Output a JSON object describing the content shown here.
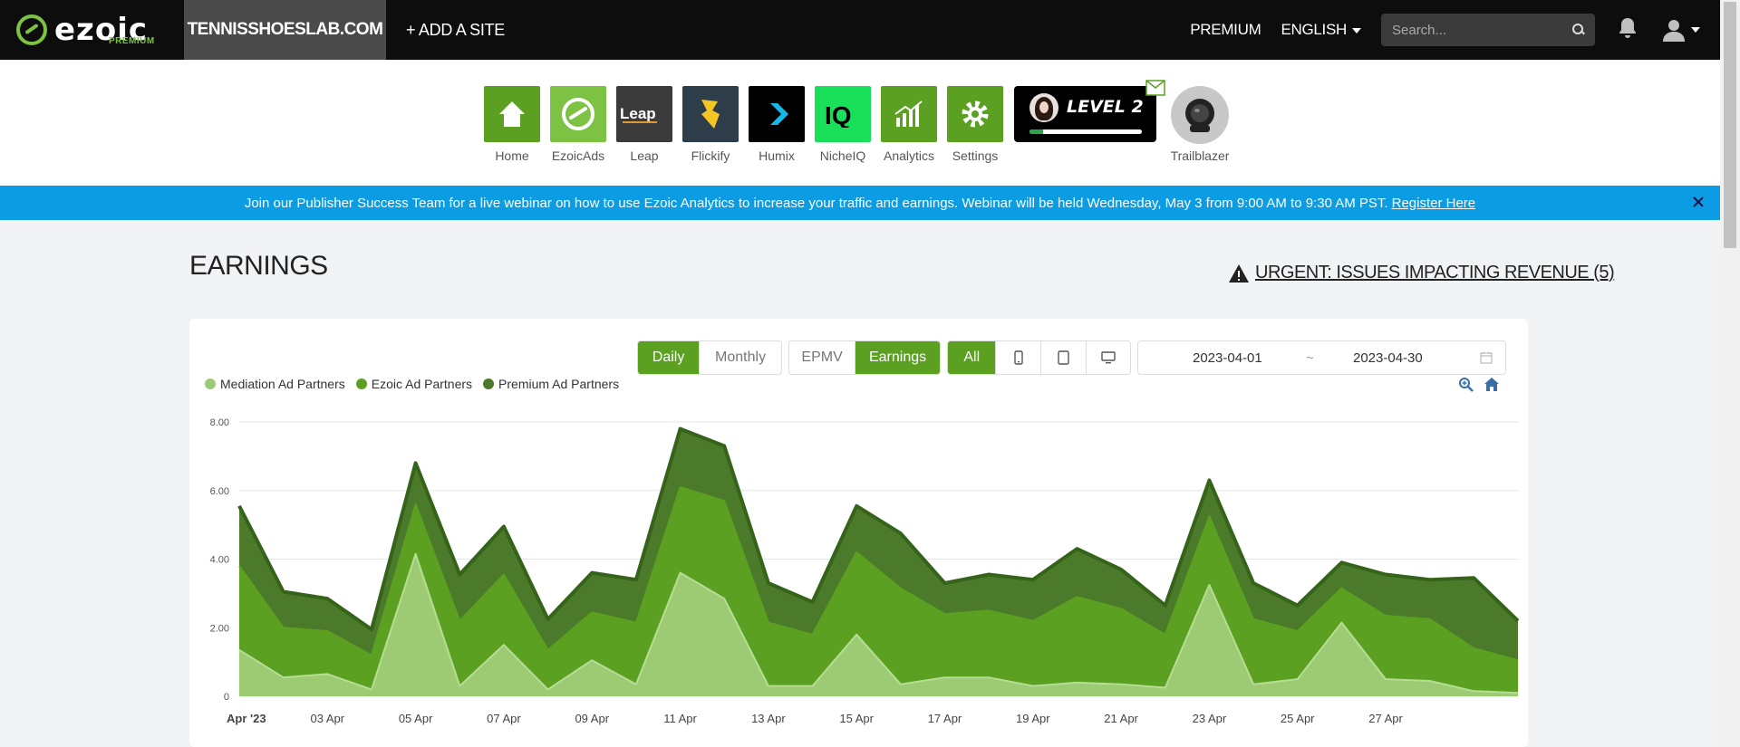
{
  "brand": {
    "name": "ezoic",
    "tag": "PREMIUM"
  },
  "nav": {
    "site": "TENNISSHOESLAB.COM",
    "add_site": "+ ADD A SITE",
    "premium": "PREMIUM",
    "language": "ENGLISH",
    "search_placeholder": "Search..."
  },
  "apps": [
    {
      "label": "Home",
      "color": "#5ba021",
      "icon": "home-icon"
    },
    {
      "label": "EzoicAds",
      "color": "#7dc242",
      "icon": "ezoic-icon"
    },
    {
      "label": "Leap",
      "color": "#3b3b3b",
      "icon": "leap-icon"
    },
    {
      "label": "Flickify",
      "color": "#2e3d4a",
      "icon": "flickify-icon"
    },
    {
      "label": "Humix",
      "color": "#000000",
      "icon": "humix-icon"
    },
    {
      "label": "NicheIQ",
      "color": "#19e058",
      "icon": "nicheiq-icon"
    },
    {
      "label": "Analytics",
      "color": "#5ba021",
      "icon": "analytics-icon"
    },
    {
      "label": "Settings",
      "color": "#5ba021",
      "icon": "settings-icon"
    }
  ],
  "level": {
    "label": "LEVEL 2",
    "progress": 0.12
  },
  "trailblazer": {
    "label": "Trailblazer"
  },
  "banner": {
    "text": "Join our Publisher Success Team for a live webinar on how to use Ezoic Analytics to increase your traffic and earnings. Webinar will be held Wednesday, May 3 from 9:00 AM to 9:30 AM PST.",
    "link": "Register Here"
  },
  "page": {
    "title": "EARNINGS",
    "urgent": "URGENT: ISSUES IMPACTING REVENUE (5)"
  },
  "controls": {
    "period": [
      "Daily",
      "Monthly"
    ],
    "metric": [
      "EPMV",
      "Earnings"
    ],
    "device_all": "All",
    "date_start": "2023-04-01",
    "date_sep": "~",
    "date_end": "2023-04-30"
  },
  "chart_data": {
    "type": "area",
    "stacked": true,
    "yticks": [
      "0",
      "2.00",
      "4.00",
      "6.00",
      "8.00"
    ],
    "ylim": [
      0,
      8
    ],
    "xticks": [
      {
        "day": 1,
        "label": "Apr '23"
      },
      {
        "day": 3,
        "label": "03 Apr"
      },
      {
        "day": 5,
        "label": "05 Apr"
      },
      {
        "day": 7,
        "label": "07 Apr"
      },
      {
        "day": 9,
        "label": "09 Apr"
      },
      {
        "day": 11,
        "label": "11 Apr"
      },
      {
        "day": 13,
        "label": "13 Apr"
      },
      {
        "day": 15,
        "label": "15 Apr"
      },
      {
        "day": 17,
        "label": "17 Apr"
      },
      {
        "day": 19,
        "label": "19 Apr"
      },
      {
        "day": 21,
        "label": "21 Apr"
      },
      {
        "day": 23,
        "label": "23 Apr"
      },
      {
        "day": 25,
        "label": "25 Apr"
      },
      {
        "day": 27,
        "label": "27 Apr"
      }
    ],
    "days": [
      1,
      2,
      3,
      4,
      5,
      6,
      7,
      8,
      9,
      10,
      11,
      12,
      13,
      14,
      15,
      16,
      17,
      18,
      19,
      20,
      21,
      22,
      23,
      24,
      25,
      26,
      27,
      28,
      29,
      30
    ],
    "series": [
      {
        "name": "Mediation Ad Partners",
        "color": "#9ccb74",
        "values": [
          1.35,
          0.55,
          0.65,
          0.2,
          4.15,
          0.3,
          1.5,
          0.2,
          1.05,
          0.35,
          3.6,
          2.85,
          0.3,
          0.3,
          1.8,
          0.35,
          0.55,
          0.55,
          0.3,
          0.4,
          0.35,
          0.25,
          3.25,
          0.35,
          0.5,
          2.15,
          0.5,
          0.45,
          0.15,
          0.1
        ]
      },
      {
        "name": "Ezoic Ad Partners",
        "color": "#5ba021",
        "values": [
          2.45,
          1.45,
          1.25,
          1.0,
          1.45,
          1.9,
          2.05,
          1.15,
          1.4,
          1.8,
          2.5,
          2.85,
          1.85,
          1.5,
          2.4,
          2.8,
          1.85,
          1.95,
          1.9,
          2.5,
          2.2,
          1.55,
          2.0,
          1.9,
          1.4,
          1.0,
          1.85,
          1.8,
          1.25,
          0.95
        ]
      },
      {
        "name": "Premium Ad Partners",
        "color": "#4a7a2a",
        "values": [
          1.75,
          1.05,
          0.95,
          0.75,
          1.2,
          1.35,
          1.4,
          0.9,
          1.15,
          1.25,
          1.7,
          1.6,
          1.15,
          0.95,
          1.35,
          1.6,
          0.9,
          1.05,
          1.2,
          1.4,
          1.15,
          0.85,
          1.05,
          1.05,
          0.75,
          0.75,
          1.2,
          1.15,
          2.05,
          1.15
        ]
      }
    ]
  }
}
